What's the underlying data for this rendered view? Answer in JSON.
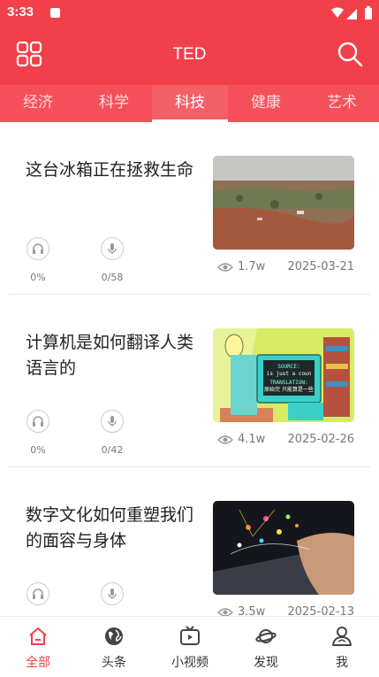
{
  "status": {
    "time": "3:33"
  },
  "header": {
    "title": "TED",
    "menu_icon": "grid-icon",
    "search_icon": "search-icon"
  },
  "tabs": [
    {
      "label": "经济"
    },
    {
      "label": "科学"
    },
    {
      "label": "科技",
      "active": true
    },
    {
      "label": "健康"
    },
    {
      "label": "艺术"
    }
  ],
  "articles": [
    {
      "title": "这台冰箱正在拯救生命",
      "listen": "0%",
      "speak": "0/58",
      "views": "1.7w",
      "date": "2025-03-21"
    },
    {
      "title": "计算机是如何翻译人类语言的",
      "listen": "0%",
      "speak": "0/42",
      "views": "4.1w",
      "date": "2025-02-26",
      "thumb_text_1": "SOURCE:",
      "thumb_text_2": "is just a coun",
      "thumb_text_3": "TRANSLATION:",
      "thumb_text_4": "原始完 只能算是一些"
    },
    {
      "title": "数字文化如何重塑我们的面容与身体",
      "listen": "",
      "speak": "",
      "views": "3.5w",
      "date": "2025-02-13"
    }
  ],
  "bottom_nav": [
    {
      "label": "全部",
      "icon": "home-icon",
      "active": true
    },
    {
      "label": "头条",
      "icon": "globe-icon"
    },
    {
      "label": "小视频",
      "icon": "tv-icon"
    },
    {
      "label": "发现",
      "icon": "planet-icon"
    },
    {
      "label": "我",
      "icon": "user-icon"
    }
  ],
  "colors": {
    "primary": "#f2404a",
    "tab_bar": "#f5505a"
  }
}
